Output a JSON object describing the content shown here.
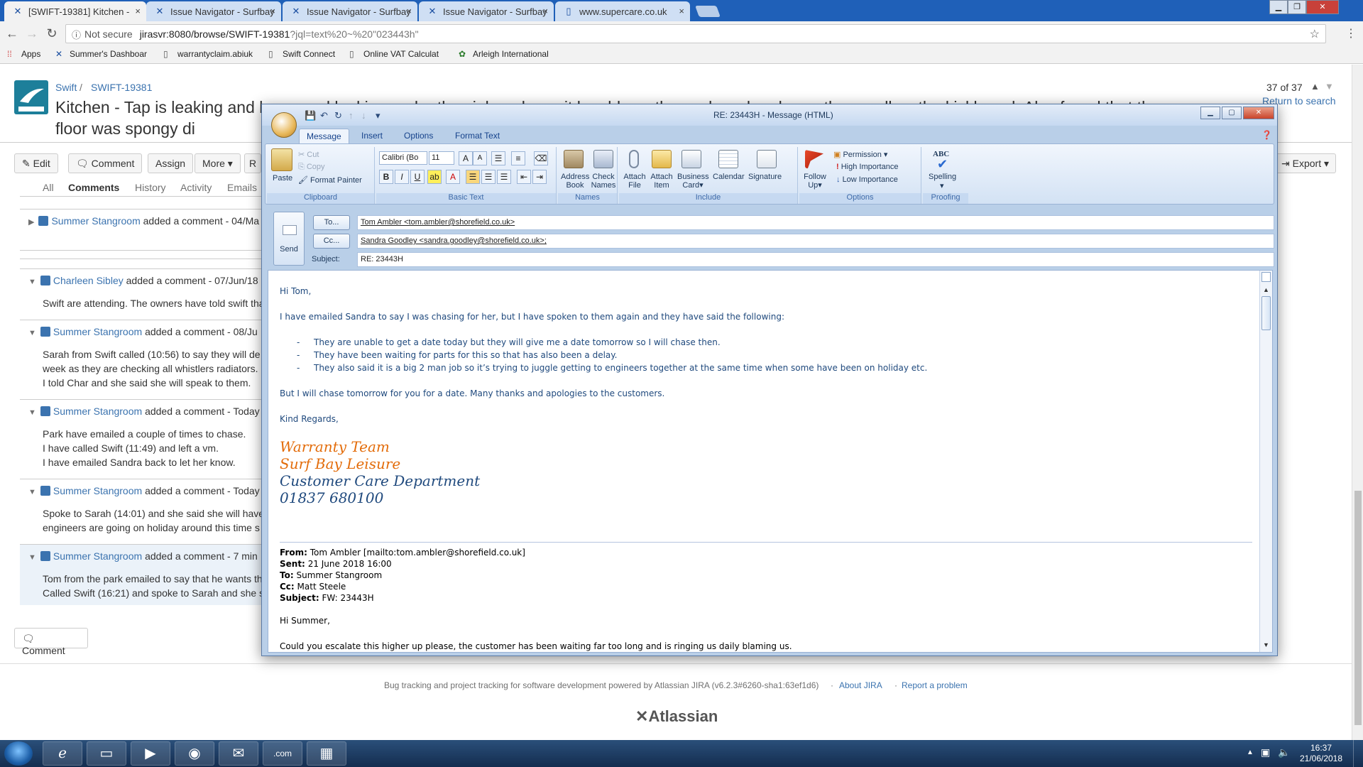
{
  "browser": {
    "tabs": [
      {
        "label": "[SWIFT-19381] Kitchen -"
      },
      {
        "label": "Issue Navigator - Surfbay"
      },
      {
        "label": "Issue Navigator - Surfbay"
      },
      {
        "label": "Issue Navigator - Surfbay"
      },
      {
        "label": "www.supercare.co.uk"
      }
    ],
    "not_secure": "Not secure",
    "url_host": "jirasvr:8080/browse/SWIFT-19381",
    "url_query": "?jql=text%20~%20\"023443h\"",
    "bookmarks": [
      "Apps",
      "Summer's Dashboar",
      "warrantyclaim.abiuk",
      "Swift Connect",
      "Online VAT Calculat",
      "Arleigh International"
    ]
  },
  "jira": {
    "project": "Swift",
    "separator": "/",
    "issue_key": "SWIFT-19381",
    "issue_title": "Kitchen - Tap is leaking and loose and leaking under the sink and now it has blown the cupboard underneath as well as the kickboard. Also found that the floor was spongy di",
    "pager": "37 of 37",
    "return_link": "Return to search",
    "actions": {
      "edit": "Edit",
      "comment": "Comment",
      "assign": "Assign",
      "more": "More",
      "export": "Export"
    },
    "tabs": {
      "all": "All",
      "comments": "Comments",
      "history": "History",
      "activity": "Activity",
      "emails": "Emails"
    },
    "comments": [
      {
        "author": "Summer Stangroom",
        "meta": "added a comment - 04/Ma",
        "lines": []
      },
      {
        "author": "Charleen Sibley",
        "meta": "added a comment - 07/Jun/18",
        "lines": [
          "Swift are attending. The owners have told swift tha"
        ]
      },
      {
        "author": "Summer Stangroom",
        "meta": "added a comment - 08/Ju",
        "lines": [
          "Sarah from Swift called (10:56) to say they will de",
          "week as they are checking all whistlers radiators.",
          "I told Char and she said she will speak to them."
        ]
      },
      {
        "author": "Summer Stangroom",
        "meta": "added a comment - Today",
        "lines": [
          "Park have emailed a couple of times to chase.",
          "I have called Swift (11:49) and left a vm.",
          "I have emailed Sandra back to let her know."
        ]
      },
      {
        "author": "Summer Stangroom",
        "meta": "added a comment - Today",
        "lines": [
          "Spoke to Sarah (14:01) and she said she will have",
          "engineers are going on holiday around this time s"
        ]
      },
      {
        "author": "Summer Stangroom",
        "meta": "added a comment - 7 min",
        "lines": [
          "Tom from the park emailed to say that he wants th",
          "Called Swift (16:21) and spoke to Sarah and she s"
        ]
      }
    ],
    "bottom_comment": "Comment",
    "footer": "Bug tracking and project tracking for software development powered by Atlassian JIRA (v6.2.3#6260-sha1:63ef1d6)",
    "footer_dot": "·",
    "about": "About JIRA",
    "report": "Report a problem",
    "atlassian": "Atlassian"
  },
  "outlook": {
    "title": "RE: 23443H - Message (HTML)",
    "ribbon_tabs": [
      "Message",
      "Insert",
      "Options",
      "Format Text"
    ],
    "clipboard": {
      "paste": "Paste",
      "cut": "Cut",
      "copy": "Copy",
      "format_painter": "Format Painter",
      "label": "Clipboard"
    },
    "basic_text": {
      "font": "Calibri (Bo",
      "size": "11",
      "label": "Basic Text"
    },
    "names": {
      "address_book": [
        "Address",
        "Book"
      ],
      "check_names": [
        "Check",
        "Names"
      ],
      "label": "Names"
    },
    "include": {
      "attach_file": [
        "Attach",
        "File"
      ],
      "attach_item": [
        "Attach",
        "Item"
      ],
      "business_card": [
        "Business",
        "Card"
      ],
      "calendar": "Calendar",
      "signature": "Signature",
      "label": "Include"
    },
    "options": {
      "follow_up": [
        "Follow",
        "Up"
      ],
      "permission": "Permission",
      "high": "High Importance",
      "low": "Low Importance",
      "label": "Options"
    },
    "proofing": {
      "abc": "ABC",
      "spelling": "Spelling",
      "label": "Proofing"
    },
    "send": "Send",
    "to_btn": "To...",
    "cc_btn": "Cc...",
    "subject_lbl": "Subject:",
    "to": "Tom Ambler <tom.ambler@shorefield.co.uk>",
    "cc": "Sandra Goodley <sandra.goodley@shorefield.co.uk>;",
    "subject": "RE: 23443H",
    "body": {
      "greeting": "Hi Tom,",
      "p1": "I have emailed Sandra to say I was chasing for her, but I have spoken to them again and they have said the following:",
      "bullets": [
        "They are unable to get a date today but they will give me a date tomorrow so I will chase then.",
        "They have been waiting for parts for this so that has also been a delay.",
        "They also said it is a big 2 man job so it’s trying to juggle getting to engineers together at the same time when some have been on holiday etc."
      ],
      "p2": "But I will chase tomorrow for you for a date.  Many thanks and apologies to the customers.",
      "regards": "Kind Regards,",
      "sig": [
        "Warranty Team",
        "Surf Bay Leisure",
        "Customer Care Department",
        "01837 680100"
      ],
      "from_lbl": "From:",
      "from": "Tom Ambler [mailto:tom.ambler@shorefield.co.uk]",
      "sent_lbl": "Sent:",
      "sent": "21 June 2018 16:00",
      "to_lbl": "To:",
      "to": "Summer Stangroom",
      "cc_lbl": "Cc:",
      "cc": "Matt Steele",
      "subj_lbl": "Subject:",
      "subj": "FW: 23443H",
      "quoted_greeting": "Hi Summer,",
      "quoted_p1": "Could you escalate this higher up please, the customer has been waiting far too long and is ringing us daily blaming us."
    }
  },
  "taskbar": {
    "time": "16:37",
    "date": "21/06/2018"
  }
}
